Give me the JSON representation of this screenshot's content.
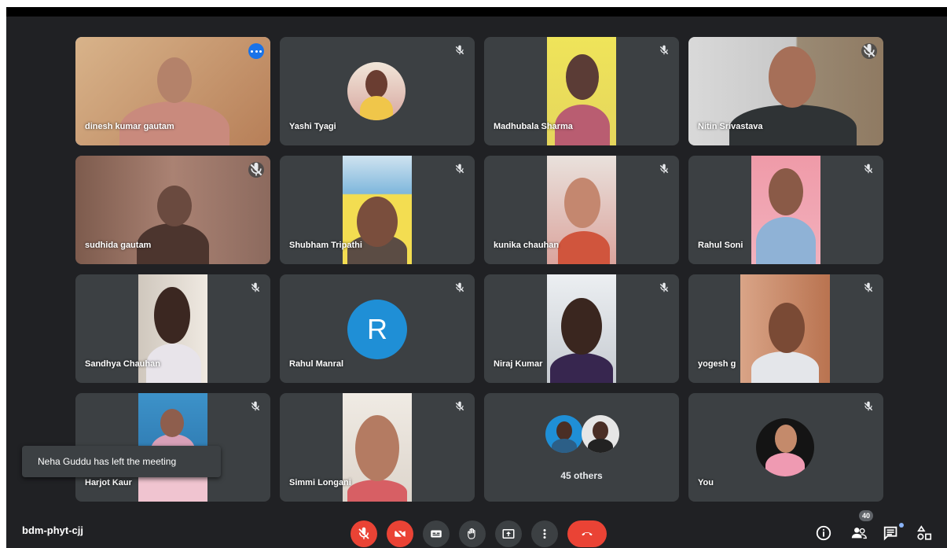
{
  "meeting": {
    "code": "bdm-phyt-cjj",
    "participant_count": "40",
    "toast": "Neha Guddu has left the meeting"
  },
  "tiles": [
    {
      "name": "dinesh kumar gautam",
      "muted": false
    },
    {
      "name": "Yashi Tyagi",
      "muted": true
    },
    {
      "name": "Madhubala Sharma",
      "muted": true
    },
    {
      "name": "Nitin Srivastava",
      "muted": true
    },
    {
      "name": "sudhida gautam",
      "muted": true
    },
    {
      "name": "Shubham Tripathi",
      "muted": true
    },
    {
      "name": "kunika chauhan",
      "muted": true
    },
    {
      "name": "Rahul Soni",
      "muted": true
    },
    {
      "name": "Sandhya Chauhan",
      "muted": true
    },
    {
      "name": "Rahul Manral",
      "muted": true,
      "initial": "R"
    },
    {
      "name": "Niraj Kumar",
      "muted": true
    },
    {
      "name": "yogesh g",
      "muted": true
    },
    {
      "name": "Harjot Kaur",
      "muted": true
    },
    {
      "name": "Simmi Longani",
      "muted": true
    },
    {
      "name": "",
      "muted": false,
      "others": "45 others"
    },
    {
      "name": "You",
      "muted": true
    }
  ],
  "colors": {
    "background": "#202124",
    "tile": "#3c4043",
    "active_outline": "#8ab4f8",
    "end_call": "#ea4335",
    "avatar_blue": "#1f8fd6"
  },
  "icons": {
    "mic_off": "mic-off-icon",
    "camera_off": "camera-off-icon",
    "captions": "captions-icon",
    "raise_hand": "raise-hand-icon",
    "present": "present-icon",
    "more": "more-vert-icon",
    "end_call": "phone-hangup-icon",
    "info": "info-icon",
    "people": "people-icon",
    "chat": "chat-icon",
    "activities": "activities-icon"
  }
}
